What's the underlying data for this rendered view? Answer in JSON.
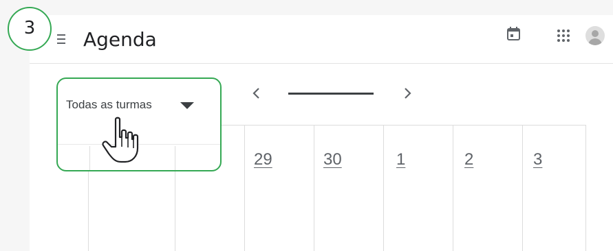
{
  "step": {
    "number": "3"
  },
  "header": {
    "title": "Agenda",
    "icons": [
      "menu-icon",
      "calendar-icon",
      "apps-icon",
      "account-avatar"
    ]
  },
  "filter": {
    "selected": "Todas as turmas",
    "icon": "dropdown-caret-icon"
  },
  "nav": {
    "prev_icon": "chevron-left-icon",
    "next_icon": "chevron-right-icon"
  },
  "week": {
    "days": [
      "29",
      "30",
      "1",
      "2",
      "3"
    ]
  },
  "cursor": {
    "icon": "hand-pointer-icon"
  },
  "colors": {
    "highlight": "#34a853",
    "text": "#3c4043",
    "grid": "#dcdcdc"
  }
}
